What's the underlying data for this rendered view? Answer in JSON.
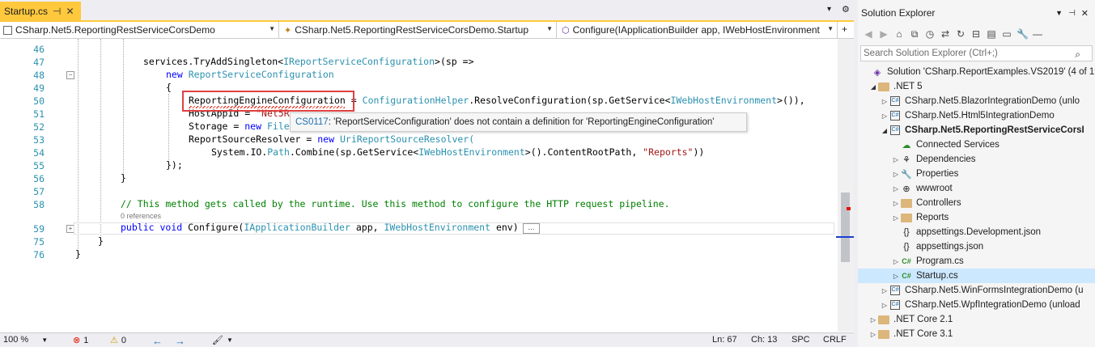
{
  "editor": {
    "tab_title": "Startup.cs",
    "nav": {
      "project": "CSharp.Net5.ReportingRestServiceCorsDemo",
      "class": "CSharp.Net5.ReportingRestServiceCorsDemo.Startup",
      "member": "Configure(IApplicationBuilder app, IWebHostEnvironment"
    },
    "lines": {
      "n46": "46",
      "n47": "47",
      "n48": "48",
      "n49": "49",
      "n50": "50",
      "n51": "51",
      "n52": "52",
      "n53": "53",
      "n54": "54",
      "n55": "55",
      "n56": "56",
      "n57": "57",
      "n58": "58",
      "n59": "59",
      "n75": "75",
      "n76": "76"
    },
    "code": {
      "l47_a": "services.TryAddSingleton<",
      "l47_b": "IReportServiceConfiguration",
      "l47_c": ">(sp =>",
      "l48_kw": "new",
      "l48_ty": "ReportServiceConfiguration",
      "l49": "{",
      "l50_a": "ReportingEngineConfiguration",
      "l50_b": " = ",
      "l50_c": "ConfigurationHelper",
      "l50_d": ".ResolveConfiguration(sp.GetService<",
      "l50_e": "IWebHostEnvironment",
      "l50_f": ">()),",
      "l51_a": "HostAppId = ",
      "l51_b": "\"Net5R",
      "l52_a": "Storage = ",
      "l52_b": "new",
      "l52_c": "File",
      "l53_a": "ReportSourceResolver = ",
      "l53_b": "new",
      "l53_c": "UriReportSourceResolver(",
      "l54_a": "System.IO.",
      "l54_b": "Path",
      "l54_c": ".Combine(sp.GetService<",
      "l54_d": "IWebHostEnvironment",
      "l54_e": ">().ContentRootPath, ",
      "l54_f": "\"Reports\"",
      "l54_g": "))",
      "l55": "});",
      "l56": "}",
      "l58": "// This method gets called by the runtime. Use this method to configure the HTTP request pipeline.",
      "refs": "0 references",
      "l59_a": "public",
      "l59_b": "void",
      "l59_c": " Configure(",
      "l59_d": "IApplicationBuilder",
      "l59_e": " app, ",
      "l59_f": "IWebHostEnvironment",
      "l59_g": " env)",
      "l59_dots": "...",
      "l75": "}",
      "l76": "}"
    },
    "tooltip": {
      "code": "CS0117",
      "message": ": 'ReportServiceConfiguration' does not contain a definition for 'ReportingEngineConfiguration'"
    }
  },
  "status": {
    "zoom": "100 %",
    "errors": "1",
    "warnings": "0",
    "ln": "Ln: 67",
    "ch": "Ch: 13",
    "spc": "SPC",
    "crlf": "CRLF"
  },
  "solution_explorer": {
    "title": "Solution Explorer",
    "search_placeholder": "Search Solution Explorer (Ctrl+;)",
    "items": [
      {
        "label": "Solution 'CSharp.ReportExamples.VS2019' (4 of 19"
      },
      {
        "label": ".NET 5"
      },
      {
        "label": "CSharp.Net5.BlazorIntegrationDemo (unlo"
      },
      {
        "label": "CSharp.Net5.Html5IntegrationDemo"
      },
      {
        "label": "CSharp.Net5.ReportingRestServiceCorsI"
      },
      {
        "label": "Connected Services"
      },
      {
        "label": "Dependencies"
      },
      {
        "label": "Properties"
      },
      {
        "label": "wwwroot"
      },
      {
        "label": "Controllers"
      },
      {
        "label": "Reports"
      },
      {
        "label": "appsettings.Development.json"
      },
      {
        "label": "appsettings.json"
      },
      {
        "label": "Program.cs"
      },
      {
        "label": "Startup.cs"
      },
      {
        "label": "CSharp.Net5.WinFormsIntegrationDemo (u"
      },
      {
        "label": "CSharp.Net5.WpfIntegrationDemo (unload"
      },
      {
        "label": ".NET Core 2.1"
      },
      {
        "label": ".NET Core 3.1"
      }
    ]
  },
  "colors": {
    "tab_accent": "#ffc83d",
    "error": "#e51400",
    "selection": "#cce8ff"
  }
}
